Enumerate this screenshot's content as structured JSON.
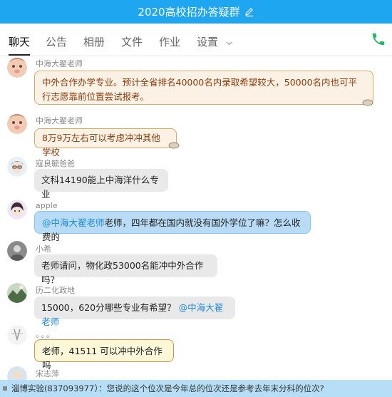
{
  "window": {
    "title": "2020高校招办答疑群"
  },
  "tabs": [
    {
      "label": "聊天",
      "active": true
    },
    {
      "label": "公告"
    },
    {
      "label": "相册"
    },
    {
      "label": "文件"
    },
    {
      "label": "作业"
    },
    {
      "label": "设置"
    }
  ],
  "colors": {
    "titlebar": "#1ea6f0",
    "mention": "#1e8ad8",
    "phone": "#29b86a",
    "bottombar": "#b6def6"
  },
  "messages": [
    {
      "sender": "中海大翟老师",
      "text": "中外合作办学专业。预计全省排名40000名内录取希望较大，50000名内也可平行志愿靠前位置尝试报考。"
    },
    {
      "sender": "中海大翟老师",
      "text": "8万9万左右可以考虑冲冲其他学校"
    },
    {
      "sender": "寇良毓爸爸",
      "text": "文科14190能上中海洋什么专业"
    },
    {
      "sender": "apple",
      "mention": "@中海大翟老师",
      "text": "老师，四年都在国内就没有国外学位了嘛？怎么收费的"
    },
    {
      "sender": "小希",
      "text": "老师请问，物化政53000名能冲中外合作吗？"
    },
    {
      "sender": "历二化政地",
      "text": "15000，620分哪些专业有希望？",
      "mention": "@中海大翟老师"
    },
    {
      "sender": "。。。",
      "text": "老师，41511  可以冲中外合作吗"
    },
    {
      "sender": "宋志萍"
    }
  ],
  "bottom_bar": {
    "text": "淄博实验(837093977）：您说的这个位次是今年总的位次还是参考去年末分科的位次?"
  }
}
